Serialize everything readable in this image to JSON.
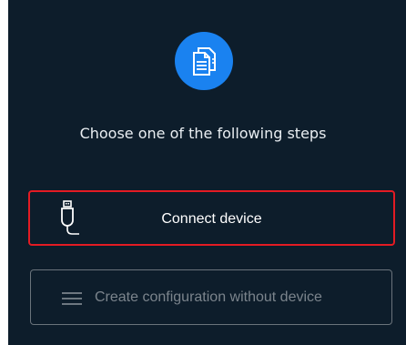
{
  "heading": "Choose one of the following steps",
  "actions": {
    "connect_label": "Connect device",
    "create_label": "Create configuration without device"
  },
  "icons": {
    "logo": "document-stack-icon",
    "connect": "usb-cable-icon",
    "create": "menu-lines-icon"
  },
  "colors": {
    "background": "#0d1d2b",
    "accent": "#1a82f0",
    "highlight_border": "#e31b23",
    "disabled_text": "#7b848c"
  }
}
